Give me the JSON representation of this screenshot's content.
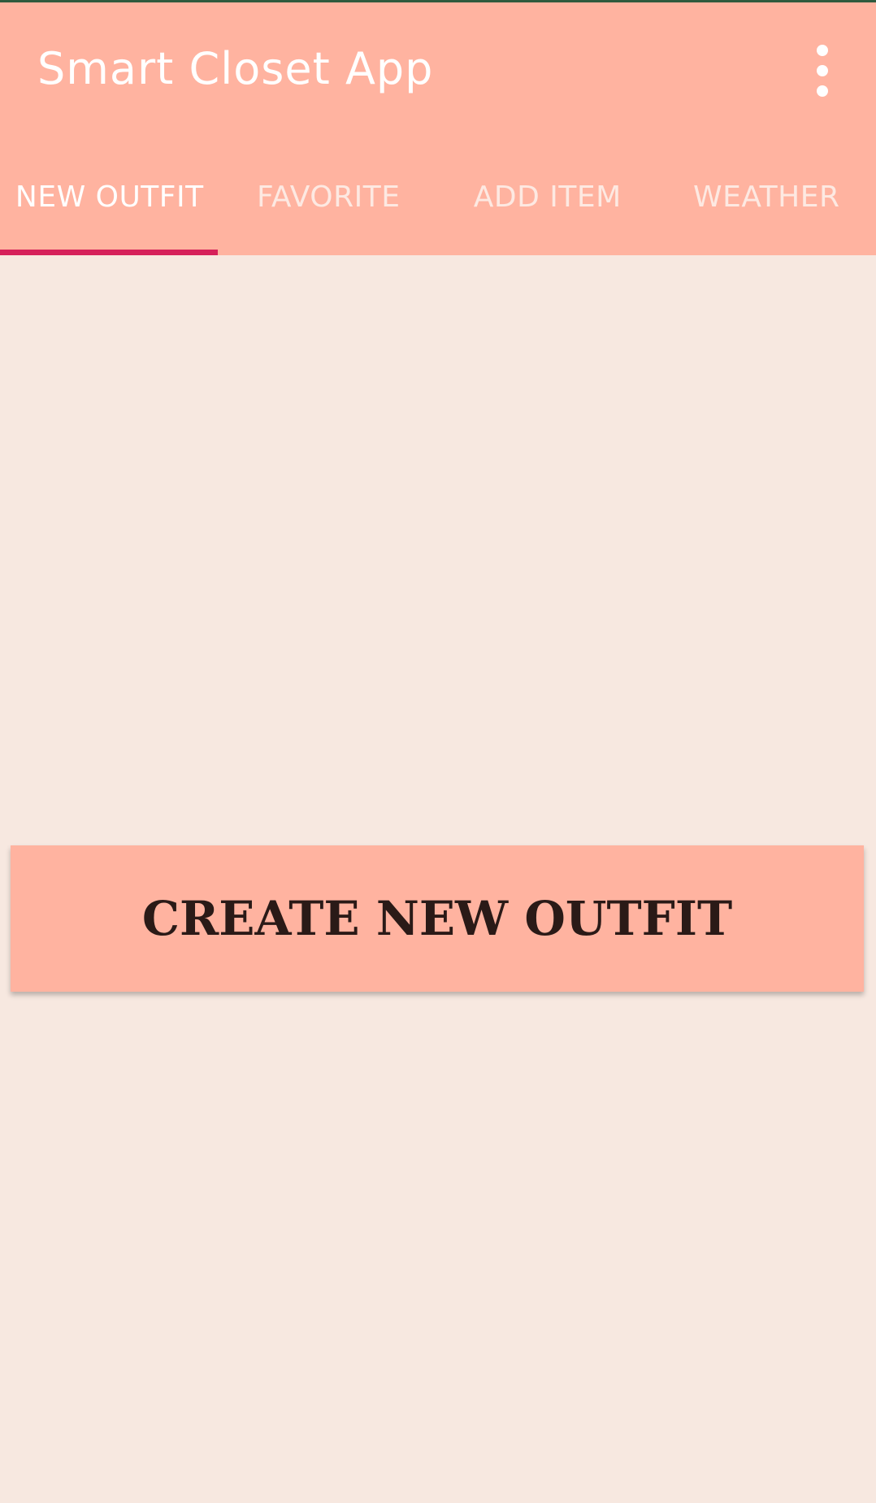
{
  "app": {
    "title": "Smart Closet App"
  },
  "toolbar": {
    "overflow_icon": "more-vert-icon"
  },
  "tabs": [
    {
      "label": "NEW OUTFIT",
      "active": true
    },
    {
      "label": "FAVORITE",
      "active": false
    },
    {
      "label": "ADD ITEM",
      "active": false
    },
    {
      "label": "WEATHER",
      "active": false
    }
  ],
  "main": {
    "create_button_label": "CREATE NEW OUTFIT"
  },
  "colors": {
    "header_background": "#ffb3a0",
    "content_background": "#f7e8e0",
    "tab_indicator": "#d6215a",
    "button_text": "#2a1a17"
  }
}
